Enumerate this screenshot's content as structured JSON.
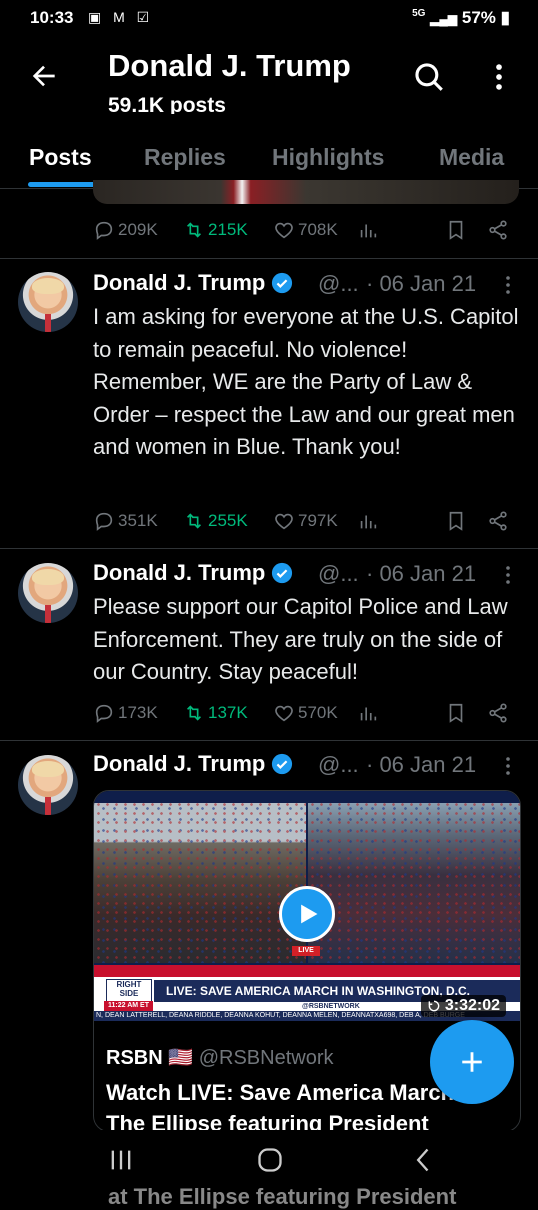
{
  "status_bar": {
    "time": "10:33",
    "notif_icons": "▣ M ☑",
    "network": "5G",
    "battery": "57%"
  },
  "header": {
    "title": "Donald J. Trump",
    "subtitle": "59.1K posts"
  },
  "tabs": [
    {
      "label": "Posts",
      "active": true
    },
    {
      "label": "Replies",
      "active": false
    },
    {
      "label": "Highlights",
      "active": false
    },
    {
      "label": "Media",
      "active": false
    }
  ],
  "previous_post_actions": {
    "replies": "209K",
    "reposts": "215K",
    "likes": "708K"
  },
  "tweets": [
    {
      "name": "Donald J. Trump",
      "handle": "@...",
      "date": "· 06 Jan 21",
      "text": "I am asking for everyone at the U.S. Capitol to remain peaceful. No violence! Remember, WE are the Party of Law & Order – respect the Law and our great men and women in Blue. Thank you!",
      "replies": "351K",
      "reposts": "255K",
      "likes": "797K"
    },
    {
      "name": "Donald J. Trump",
      "handle": "@...",
      "date": "· 06 Jan 21",
      "text": "Please support our Capitol Police and Law Enforcement. They are truly on the side of our Country. Stay peaceful!",
      "replies": "173K",
      "reposts": "137K",
      "likes": "570K"
    },
    {
      "name": "Donald J. Trump",
      "handle": "@...",
      "date": "· 06 Jan 21",
      "card": {
        "live_label": "LIVE",
        "logo": "RIGHT SIDE",
        "headline": "LIVE: SAVE AMERICA MARCH IN WASHINGTON, D.C.",
        "channel": "@RSBNETWORK",
        "time_on_screen": "11:22 AM ET",
        "ticker": "N, DEAN LATTERELL, DEANA RIDDLE, DEANNA KOHUT, DEANNA MELEN, DEANNATXA698, DEB A, DEB BURGE",
        "duration": "3:32:02",
        "quoted_name": "RSBN",
        "quoted_flag": "🇺🇸",
        "quoted_handle": "@RSBNetwork",
        "quoted_text": "Watch LIVE: Save America March at The Ellipse featuring President"
      }
    }
  ],
  "bleed_text": "at The Ellipse featuring President",
  "colors": {
    "accent": "#1d9bf0",
    "repost": "#00ba7c",
    "muted": "#71767b",
    "background": "#000000"
  }
}
